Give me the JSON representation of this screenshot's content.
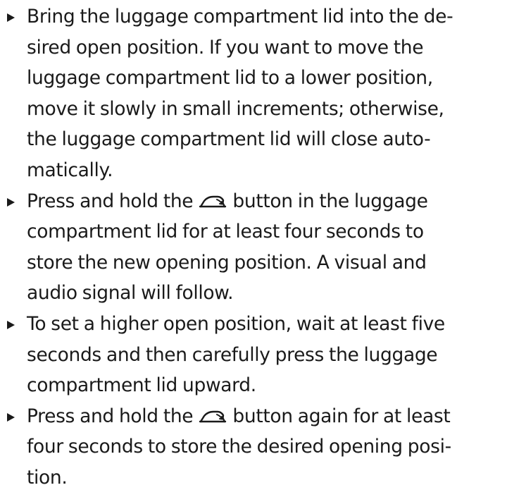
{
  "steps": [
    {
      "lines": [
        "Bring the luggage compartment lid into the de-",
        "sired open position. If you want to move the",
        "luggage compartment lid to a lower position,",
        "move it slowly in small increments; otherwise,",
        "the luggage compartment lid will close auto-",
        "matically."
      ]
    },
    {
      "line1_before_icon": "Press and hold the",
      "line1_after_icon": "button in the luggage",
      "lines": [
        "compartment lid for at least four seconds to",
        "store the new opening position. A visual and",
        "audio signal will follow."
      ]
    },
    {
      "lines": [
        "To set a higher open position, wait at least five",
        "seconds and then carefully press the luggage",
        "compartment lid upward."
      ]
    },
    {
      "line1_before_icon": "Press and hold the",
      "line1_after_icon": "button again for at least",
      "lines": [
        "four seconds to store the desired opening posi-",
        "tion."
      ]
    }
  ],
  "icons": {
    "bullet": "triangle-bullet-icon",
    "trunk_button": "luggage-compartment-lid-icon"
  }
}
